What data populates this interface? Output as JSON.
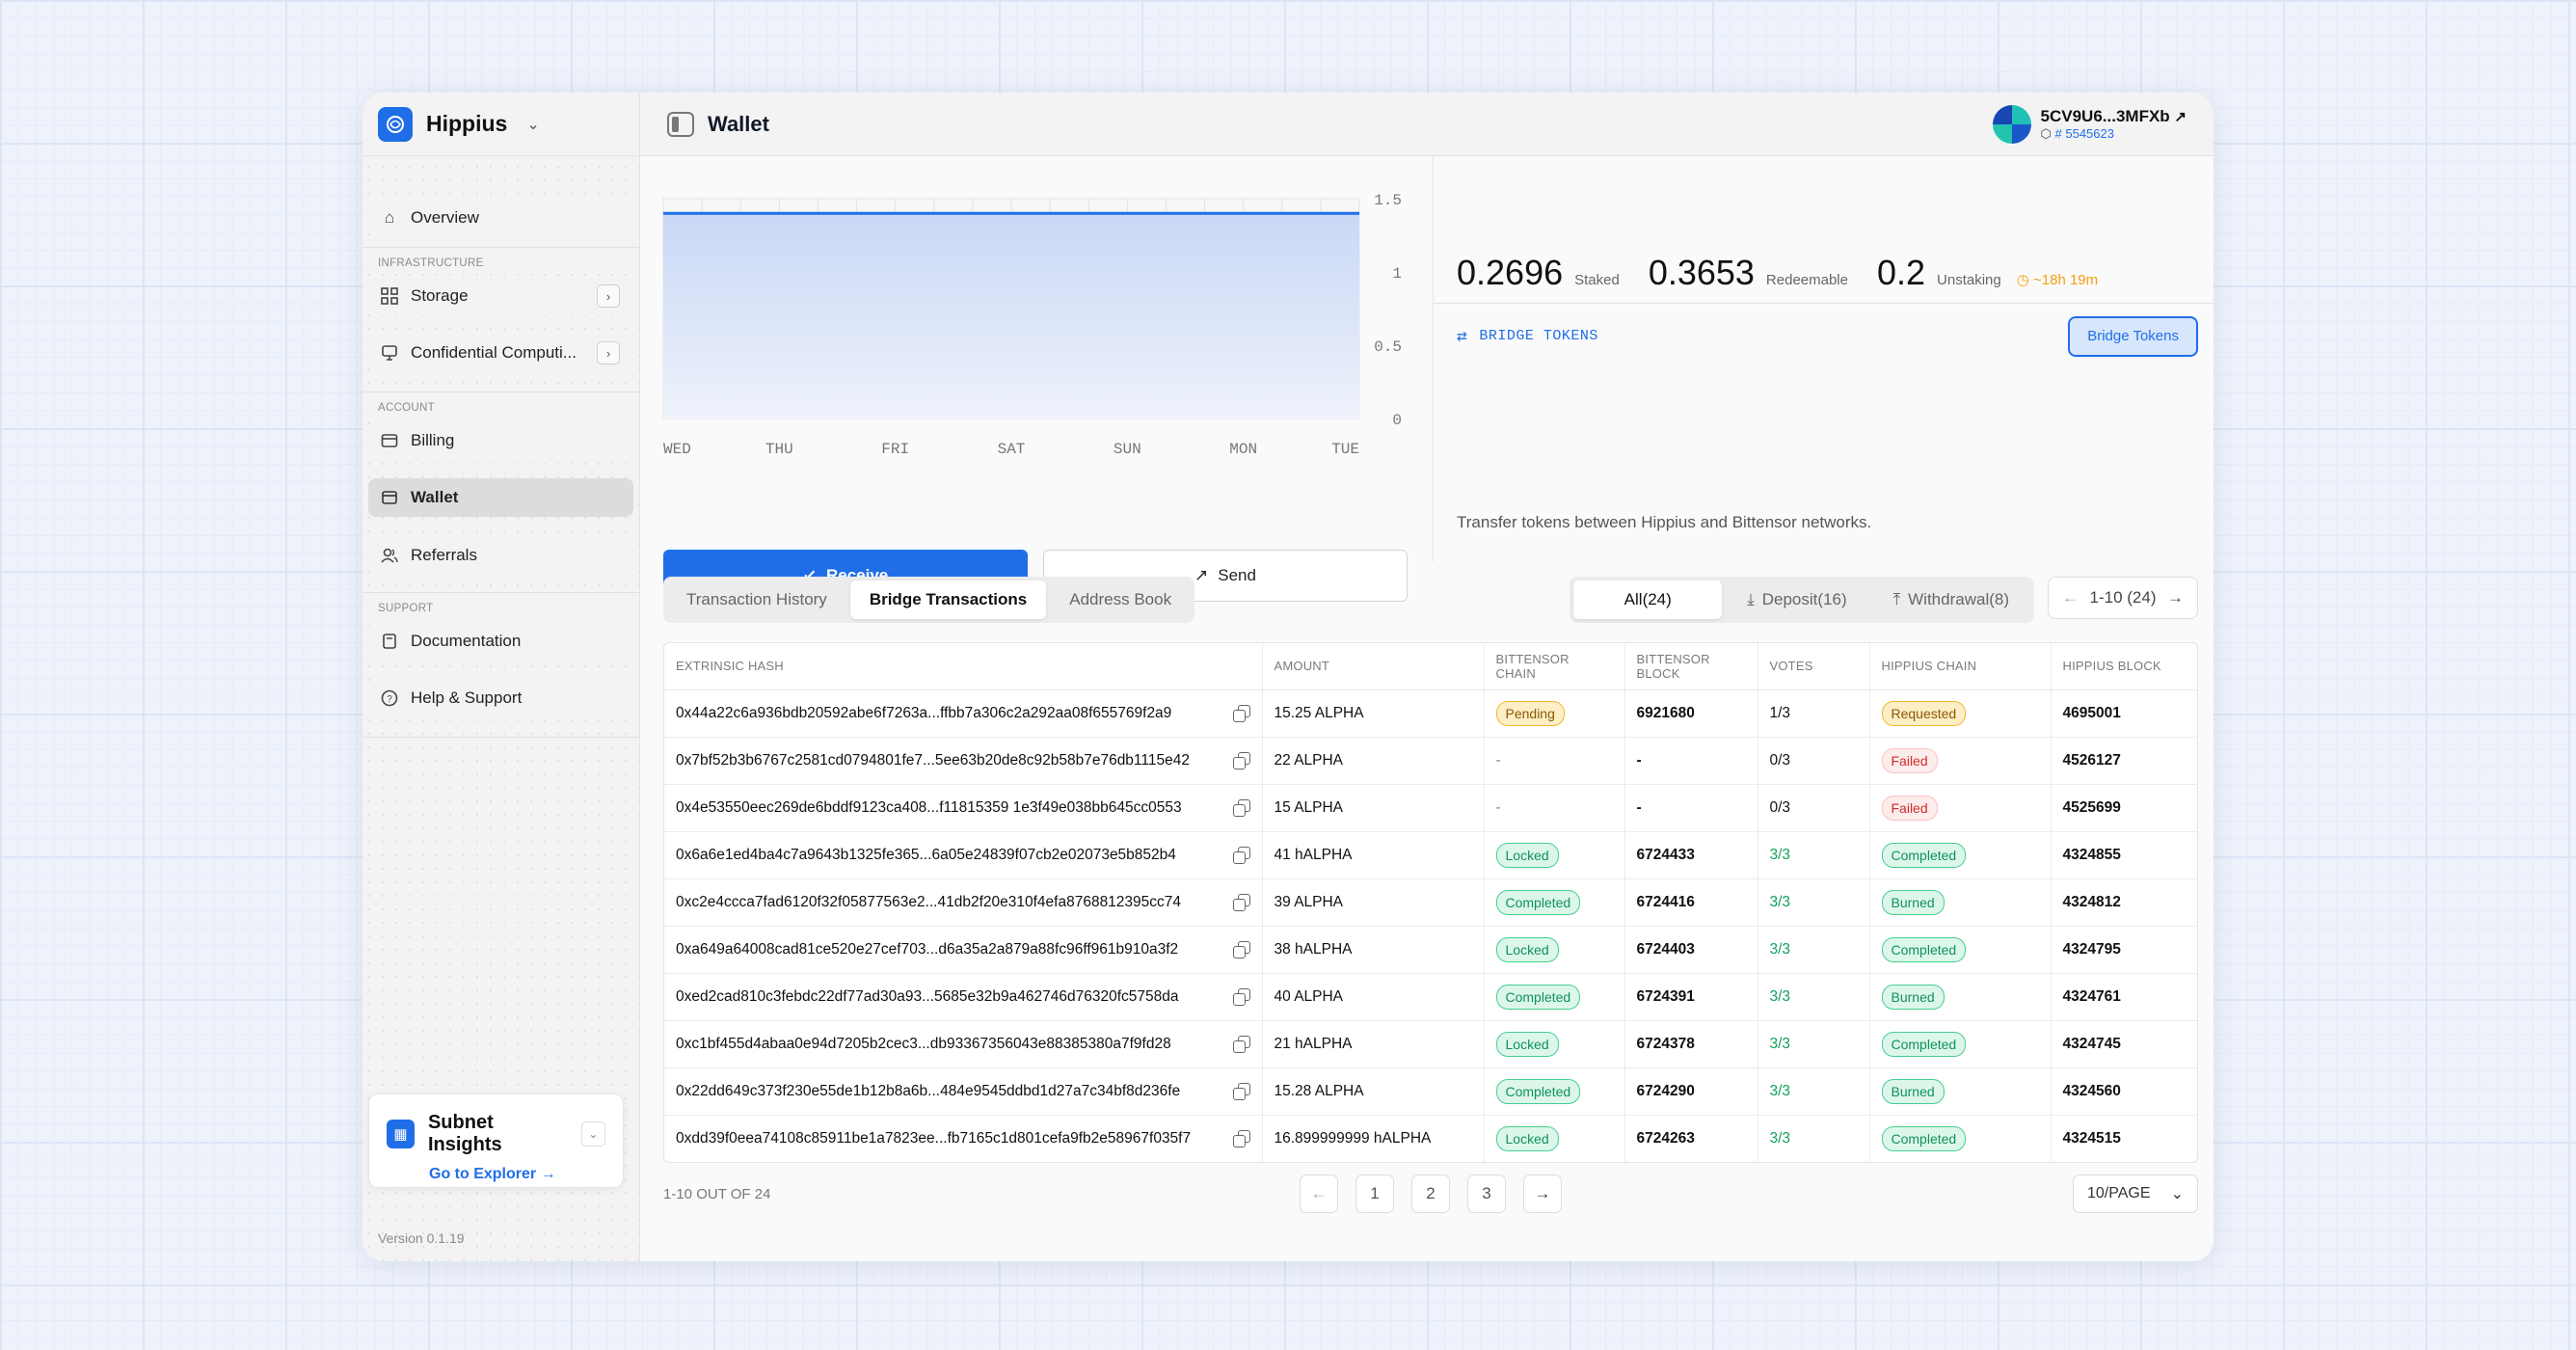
{
  "sidebar": {
    "brand": "Hippius",
    "items": {
      "overview": "Overview",
      "infra_label": "INFRASTRUCTURE",
      "storage": "Storage",
      "confidential": "Confidential Computi...",
      "account_label": "ACCOUNT",
      "billing": "Billing",
      "wallet": "Wallet",
      "referrals": "Referrals",
      "support_label": "SUPPORT",
      "documentation": "Documentation",
      "help": "Help & Support"
    },
    "insights": {
      "title": "Subnet Insights",
      "link": "Go to Explorer"
    },
    "version": "Version 0.1.19"
  },
  "header": {
    "title": "Wallet",
    "account_name": "5CV9U6...3MFXb",
    "account_block": "# 5545623"
  },
  "chart_data": {
    "type": "area",
    "categories": [
      "WED",
      "THU",
      "FRI",
      "SAT",
      "SUN",
      "MON",
      "TUE"
    ],
    "values": [
      1.4,
      1.4,
      1.4,
      1.4,
      1.4,
      1.4,
      1.4
    ],
    "y_ticks": [
      "1.5",
      "1",
      "0.5",
      "0"
    ],
    "ylim": [
      0,
      1.5
    ],
    "grid": true,
    "color": "#1f6ee8"
  },
  "actions": {
    "receive": "Receive",
    "send": "Send"
  },
  "balances": {
    "staked_value": "0.2696",
    "staked_label": "Staked",
    "redeemable_value": "0.3653",
    "redeemable_label": "Redeemable",
    "unstaking_value": "0.2",
    "unstaking_label": "Unstaking",
    "unstaking_time": "~18h 19m"
  },
  "bridge": {
    "label": "BRIDGE TOKENS",
    "button": "Bridge Tokens",
    "description": "Transfer tokens between Hippius and Bittensor networks."
  },
  "tabs": [
    "Transaction History",
    "Bridge Transactions",
    "Address Book"
  ],
  "filters": [
    "All(24)",
    "Deposit(16)",
    "Withdrawal(8)"
  ],
  "pager_top": "1-10 (24)",
  "table": {
    "headers": [
      "EXTRINSIC HASH",
      "AMOUNT",
      "BITTENSOR CHAIN",
      "BITTENSOR BLOCK",
      "VOTES",
      "HIPPIUS CHAIN",
      "HIPPIUS BLOCK"
    ],
    "rows": [
      {
        "hash": "0x44a22c6a936bdb20592abe6f7263a...ffbb7a306c2a292aa08f655769f2a9",
        "amount": "15.25 ALPHA",
        "bt_chain": "Pending",
        "bt_block": "6921680",
        "votes": "1/3",
        "hp_chain": "Requested",
        "hp_block": "4695001"
      },
      {
        "hash": "0x7bf52b3b6767c2581cd0794801fe7...5ee63b20de8c92b58b7e76db1115e42",
        "amount": "22 ALPHA",
        "bt_chain": "-",
        "bt_block": "-",
        "votes": "0/3",
        "hp_chain": "Failed",
        "hp_block": "4526127"
      },
      {
        "hash": "0x4e53550eec269de6bddf9123ca408...f11815359 1e3f49e038bb645cc0553",
        "amount": "15 ALPHA",
        "bt_chain": "-",
        "bt_block": "-",
        "votes": "0/3",
        "hp_chain": "Failed",
        "hp_block": "4525699"
      },
      {
        "hash": "0x6a6e1ed4ba4c7a9643b1325fe365...6a05e24839f07cb2e02073e5b852b4",
        "amount": "41 hALPHA",
        "bt_chain": "Locked",
        "bt_block": "6724433",
        "votes": "3/3",
        "hp_chain": "Completed",
        "hp_block": "4324855"
      },
      {
        "hash": "0xc2e4ccca7fad6120f32f05877563e2...41db2f20e310f4efa8768812395cc74",
        "amount": "39 ALPHA",
        "bt_chain": "Completed",
        "bt_block": "6724416",
        "votes": "3/3",
        "hp_chain": "Burned",
        "hp_block": "4324812"
      },
      {
        "hash": "0xa649a64008cad81ce520e27cef703...d6a35a2a879a88fc96ff961b910a3f2",
        "amount": "38 hALPHA",
        "bt_chain": "Locked",
        "bt_block": "6724403",
        "votes": "3/3",
        "hp_chain": "Completed",
        "hp_block": "4324795"
      },
      {
        "hash": "0xed2cad810c3febdc22df77ad30a93...5685e32b9a462746d76320fc5758da",
        "amount": "40 ALPHA",
        "bt_chain": "Completed",
        "bt_block": "6724391",
        "votes": "3/3",
        "hp_chain": "Burned",
        "hp_block": "4324761"
      },
      {
        "hash": "0xc1bf455d4abaa0e94d7205b2cec3...db93367356043e88385380a7f9fd28",
        "amount": "21 hALPHA",
        "bt_chain": "Locked",
        "bt_block": "6724378",
        "votes": "3/3",
        "hp_chain": "Completed",
        "hp_block": "4324745"
      },
      {
        "hash": "0x22dd649c373f230e55de1b12b8a6b...484e9545ddbd1d27a7c34bf8d236fe",
        "amount": "15.28 ALPHA",
        "bt_chain": "Completed",
        "bt_block": "6724290",
        "votes": "3/3",
        "hp_chain": "Burned",
        "hp_block": "4324560"
      },
      {
        "hash": "0xdd39f0eea74108c85911be1a7823ee...fb7165c1d801cefa9fb2e58967f035f7",
        "amount": "16.899999999 hALPHA",
        "bt_chain": "Locked",
        "bt_block": "6724263",
        "votes": "3/3",
        "hp_chain": "Completed",
        "hp_block": "4324515"
      }
    ]
  },
  "footer": {
    "count": "1-10 OUT OF 24",
    "pages": [
      "1",
      "2",
      "3"
    ],
    "per_page": "10/PAGE"
  }
}
